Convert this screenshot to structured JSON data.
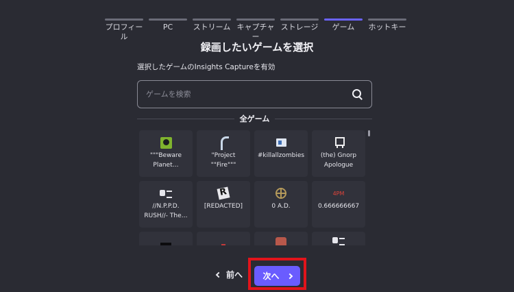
{
  "steps": [
    {
      "label": "プロフィール",
      "active": false
    },
    {
      "label": "PC",
      "active": false
    },
    {
      "label": "ストリーム",
      "active": false
    },
    {
      "label": "キャプチャー",
      "active": false
    },
    {
      "label": "ストレージ",
      "active": false
    },
    {
      "label": "ゲーム",
      "active": true
    },
    {
      "label": "ホットキー",
      "active": false
    }
  ],
  "title": "録画したいゲームを選択",
  "subtitle": "選択したゲームのInsights Captureを有効",
  "search": {
    "placeholder": "ゲームを検索",
    "icon": "search-icon"
  },
  "section_label": "全ゲーム",
  "games": [
    {
      "name": "\"\"\"Beware Planet…",
      "icon": "skull-icon"
    },
    {
      "name": "\"Project \"\"Fire\"\"\"",
      "icon": "horse-icon"
    },
    {
      "name": "#killallzombies",
      "icon": "box-icon"
    },
    {
      "name": "(the) Gnorp Apologue",
      "icon": "robot-icon"
    },
    {
      "name": "//N.P.P.D. RUSH//- The…",
      "icon": "gamepad-icon"
    },
    {
      "name": "[REDACTED]",
      "icon": "r-logo-icon"
    },
    {
      "name": "0 A.D.",
      "icon": "compass-icon"
    },
    {
      "name": "0.666666667",
      "icon": "4pm-icon",
      "icon_text": "4PM"
    }
  ],
  "nav": {
    "prev_label": "前へ",
    "next_label": "次へ"
  },
  "colors": {
    "accent": "#6a5cff",
    "highlight": "#e1141b",
    "background": "#2a2b33"
  }
}
